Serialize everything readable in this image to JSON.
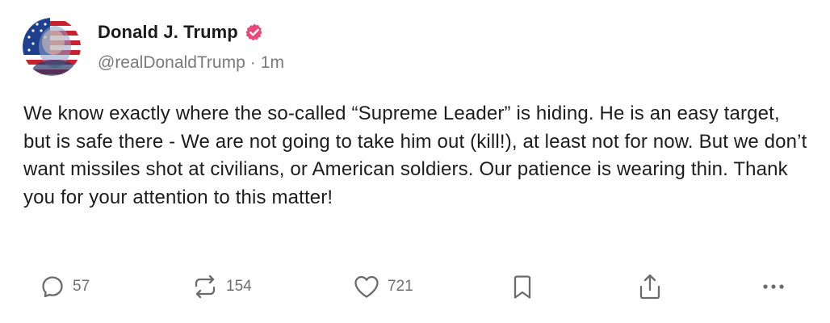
{
  "post": {
    "author": {
      "display_name": "Donald J. Trump",
      "handle": "@realDonaldTrump",
      "separator": "·",
      "time": "1m",
      "verified_color": "#e8487a"
    },
    "text": "We know exactly where the so-called “Supreme Leader” is hiding. He is an easy target, but is safe there - We are not going to take him out (kill!), at least not for now. But we don’t want missiles shot at civilians, or American soldiers. Our patience is wearing thin. Thank you for your attention to this matter!",
    "actions": {
      "reply_count": "57",
      "repost_count": "154",
      "like_count": "721"
    }
  },
  "icons": {
    "avatar": "avatar-portrait-flag",
    "verified": "verified-badge-icon",
    "reply": "reply-icon",
    "repost": "repost-icon",
    "like": "heart-icon",
    "bookmark": "bookmark-icon",
    "share": "share-icon",
    "more": "more-icon"
  }
}
